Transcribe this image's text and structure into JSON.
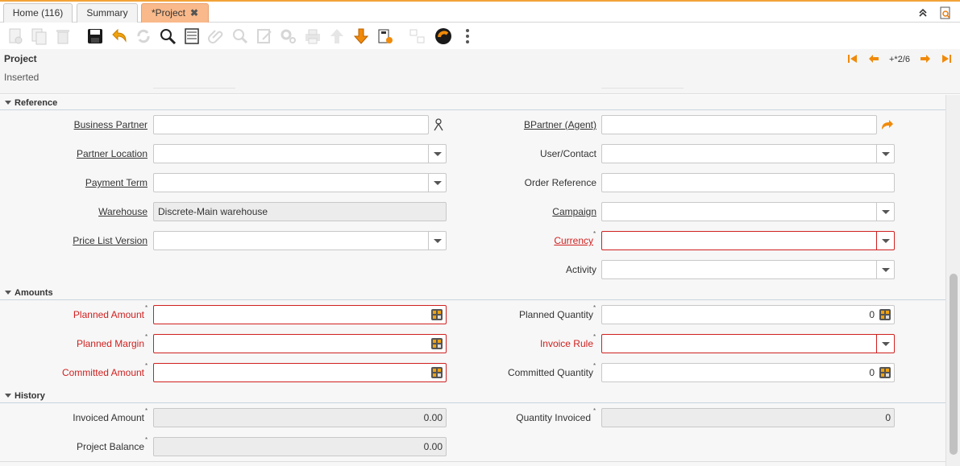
{
  "tabs": [
    {
      "label": "Home (116)"
    },
    {
      "label": "Summary"
    },
    {
      "label": "*Project",
      "close": "✖"
    }
  ],
  "header": {
    "title": "Project",
    "status": "Inserted",
    "record_nav": "+*2/6"
  },
  "sections": {
    "reference": "Reference",
    "amounts": "Amounts",
    "history": "History"
  },
  "fields": {
    "business_partner": {
      "label": "Business Partner",
      "value": ""
    },
    "partner_location": {
      "label": "Partner Location",
      "value": ""
    },
    "payment_term": {
      "label": "Payment Term",
      "value": ""
    },
    "warehouse": {
      "label": "Warehouse",
      "value": "Discrete-Main warehouse"
    },
    "price_list_version": {
      "label": "Price List Version",
      "value": ""
    },
    "bpartner_agent": {
      "label": "BPartner (Agent)",
      "value": ""
    },
    "user_contact": {
      "label": "User/Contact",
      "value": ""
    },
    "order_reference": {
      "label": "Order Reference",
      "value": ""
    },
    "campaign": {
      "label": "Campaign",
      "value": ""
    },
    "currency": {
      "label": "Currency",
      "value": ""
    },
    "activity": {
      "label": "Activity",
      "value": ""
    },
    "planned_amount": {
      "label": "Planned Amount",
      "value": ""
    },
    "planned_margin": {
      "label": "Planned Margin",
      "value": ""
    },
    "committed_amount": {
      "label": "Committed Amount",
      "value": ""
    },
    "planned_quantity": {
      "label": "Planned Quantity",
      "value": "0"
    },
    "invoice_rule": {
      "label": "Invoice Rule",
      "value": ""
    },
    "committed_quantity": {
      "label": "Committed Quantity",
      "value": "0"
    },
    "invoiced_amount": {
      "label": "Invoiced Amount",
      "value": "0.00"
    },
    "project_balance": {
      "label": "Project Balance",
      "value": "0.00"
    },
    "quantity_invoiced": {
      "label": "Quantity Invoiced",
      "value": "0"
    }
  },
  "required_marker": "*",
  "colors": {
    "accent": "#f3a339",
    "active_tab": "#f9b98a",
    "required": "#d02020",
    "toolbar_active": "#e87d0d"
  },
  "icons": [
    "new-record-icon",
    "copy-record-icon",
    "delete-icon",
    "save-icon",
    "undo-icon",
    "refresh-icon",
    "find-icon",
    "grid-toggle-icon",
    "attachment-icon",
    "zoom-across-icon",
    "chat-icon",
    "process-icon",
    "print-icon",
    "parent-record-icon",
    "detail-record-icon",
    "archive-icon",
    "workflow-icon",
    "help-icon",
    "more-icon"
  ]
}
